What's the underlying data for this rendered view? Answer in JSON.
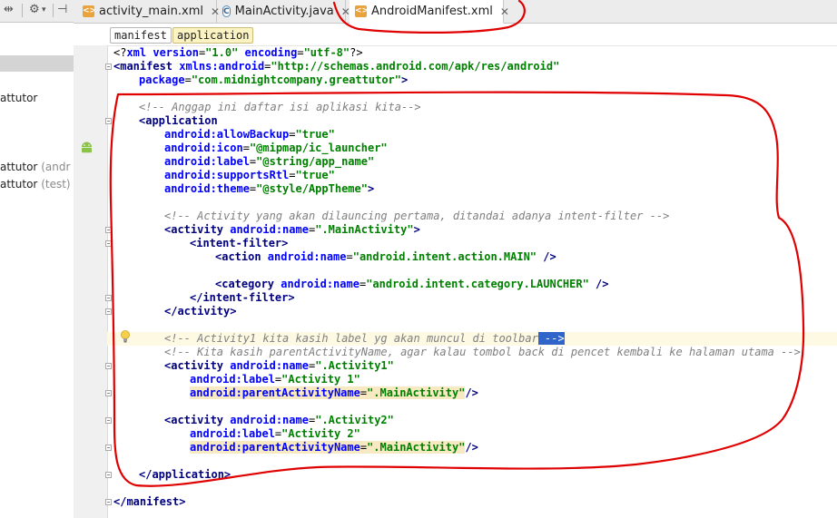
{
  "left_panel": {
    "tree_rows": [
      {
        "text": "attutor",
        "hint": ""
      },
      {
        "text": "attutor",
        "hint": "(andr"
      },
      {
        "text": "attutor",
        "hint": "(test)"
      }
    ]
  },
  "tabs": [
    {
      "label": "activity_main.xml",
      "icon": "layout-xml-icon"
    },
    {
      "label": "MainActivity.java",
      "icon": "java-class-icon"
    },
    {
      "label": "AndroidManifest.xml",
      "icon": "manifest-xml-icon"
    }
  ],
  "breadcrumb": [
    "manifest",
    "application"
  ],
  "code": {
    "l1": {
      "a": "<?",
      "b": "xml version",
      "c": "=",
      "d": "\"1.0\"",
      "e": " encoding",
      "f": "=",
      "g": "\"utf-8\"",
      "h": "?>"
    },
    "l2": {
      "a": "<manifest ",
      "b": "xmlns:android",
      "c": "=",
      "d": "\"http://schemas.android.com/apk/res/android\""
    },
    "l3": {
      "a": "package",
      "b": "=",
      "c": "\"com.midnightcompany.greattutor\"",
      "d": ">"
    },
    "l5": "<!-- Anggap ini daftar isi aplikasi kita-->",
    "l6": "<application",
    "l7": {
      "a": "android:allowBackup",
      "b": "=",
      "c": "\"true\""
    },
    "l8": {
      "a": "android:icon",
      "b": "=",
      "c": "\"@mipmap/ic_launcher\""
    },
    "l9": {
      "a": "android:label",
      "b": "=",
      "c": "\"@string/app_name\""
    },
    "l10": {
      "a": "android:supportsRtl",
      "b": "=",
      "c": "\"true\""
    },
    "l11": {
      "a": "android:theme",
      "b": "=",
      "c": "\"@style/AppTheme\"",
      "d": ">"
    },
    "l13": "<!-- Activity yang akan dilauncing pertama, ditandai adanya intent-filter -->",
    "l14": {
      "a": "<activity ",
      "b": "android:name",
      "c": "=",
      "d": "\".MainActivity\"",
      "e": ">"
    },
    "l15": "<intent-filter>",
    "l16": {
      "a": "<action ",
      "b": "android:name",
      "c": "=",
      "d": "\"android.intent.action.MAIN\"",
      "e": " />"
    },
    "l18": {
      "a": "<category ",
      "b": "android:name",
      "c": "=",
      "d": "\"android.intent.category.LAUNCHER\"",
      "e": " />"
    },
    "l19": "</intent-filter>",
    "l20": "</activity>",
    "l22": {
      "a": "<!-- Activity1 kita kasih label yg akan muncul di toolbar",
      "b": " -->"
    },
    "l23": "<!-- Kita kasih parentActivityName, agar kalau tombol back di pencet kembali ke halaman utama -->",
    "l24": {
      "a": "<activity ",
      "b": "android:name",
      "c": "=",
      "d": "\".Activity1\""
    },
    "l25": {
      "a": "android:label",
      "b": "=",
      "c": "\"Activity 1\""
    },
    "l26": {
      "a": "android:parentActivityName",
      "b": "=",
      "c": "\".MainActivity\"",
      "d": "/>"
    },
    "l28": {
      "a": "<activity ",
      "b": "android:name",
      "c": "=",
      "d": "\".Activity2\""
    },
    "l29": {
      "a": "android:label",
      "b": "=",
      "c": "\"Activity 2\""
    },
    "l30": {
      "a": "android:parentActivityName",
      "b": "=",
      "c": "\".MainActivity\"",
      "d": "/>"
    },
    "l32": "</application>",
    "l34": "</manifest>"
  },
  "colors": {
    "tag": "#000080",
    "attr": "#0000ff",
    "value": "#008000",
    "comment": "#808080",
    "annotation": "#e00000"
  }
}
